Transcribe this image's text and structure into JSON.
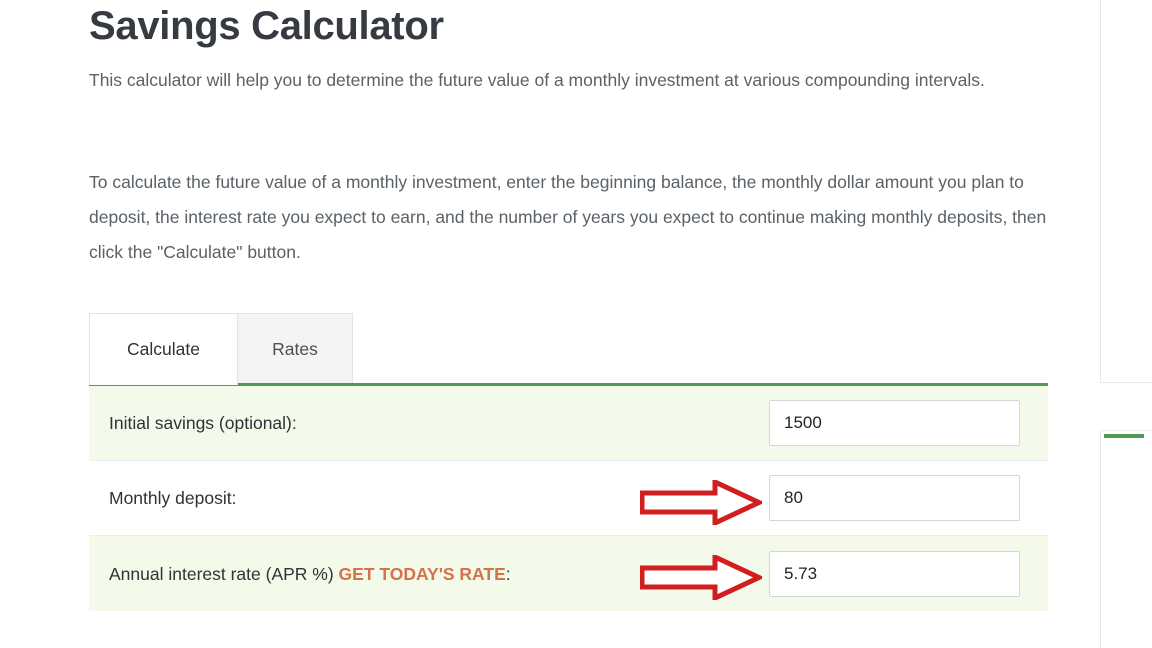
{
  "page": {
    "title": "Savings Calculator",
    "paragraphs": [
      "This calculator will help you to determine the future value of a monthly investment at various compounding intervals.",
      "To calculate the future value of a monthly investment, enter the beginning balance, the monthly dollar amount you plan to deposit, the interest rate you expect to earn, and the number of years you expect to continue making monthly deposits, then click the \"Calculate\" button."
    ]
  },
  "tabs": [
    {
      "label": "Calculate",
      "active": true
    },
    {
      "label": "Rates",
      "active": false
    }
  ],
  "form": {
    "rows": [
      {
        "label": "Initial savings (optional):",
        "value": "1500",
        "placeholder": "",
        "shaded": true,
        "annotated": false
      },
      {
        "label": "Monthly deposit:",
        "value": "80",
        "placeholder": "",
        "shaded": false,
        "annotated": true
      },
      {
        "label_prefix": "Annual interest rate (APR %) ",
        "label_link": "GET TODAY'S RATE",
        "label_suffix": ":",
        "value": "5.73",
        "placeholder": "",
        "shaded": true,
        "annotated": true
      }
    ]
  },
  "annotations": {
    "arrow_color": "#d11f1f",
    "arrow_name": "red-right-arrow",
    "count": 2
  },
  "colors": {
    "title": "#353b41",
    "body_text": "#5a6268",
    "accent_green": "#4f9a51",
    "row_shaded": "#f4faea",
    "rate_link": "#d4724a",
    "input_border": "#d6d6d6",
    "tab_inactive_bg": "#f4f4f4"
  }
}
